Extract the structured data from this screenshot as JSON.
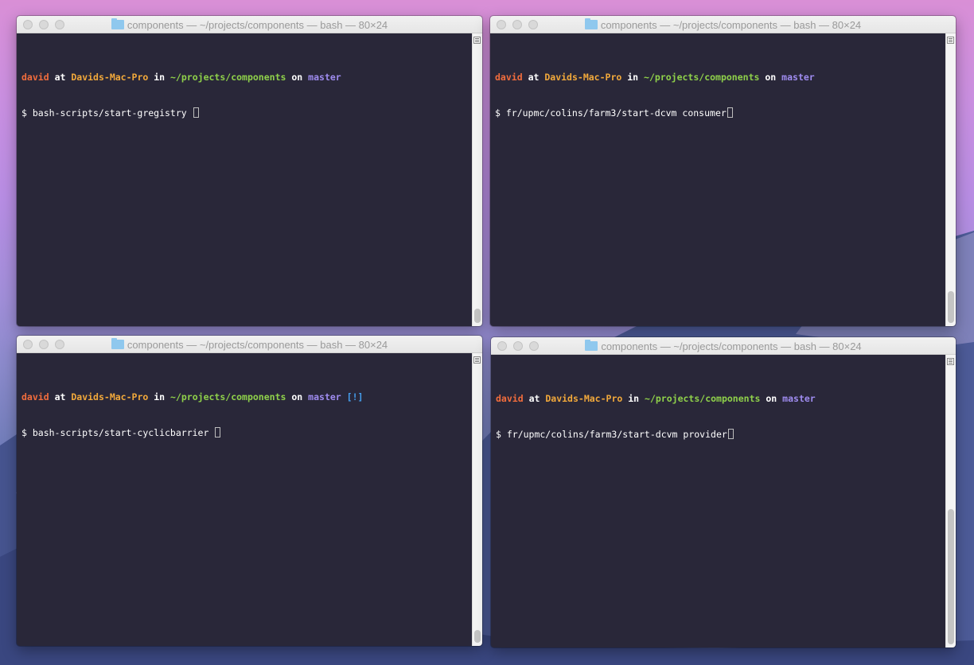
{
  "windows": [
    {
      "title": "components — ~/projects/components — bash — 80×24",
      "prompt": {
        "user": "david",
        "at": "at",
        "host": "Davids-Mac-Pro",
        "in": "in",
        "path": "~/projects/components",
        "on": "on",
        "branch": "master",
        "flag": ""
      },
      "command": "$ bash-scripts/start-gregistry "
    },
    {
      "title": "components — ~/projects/components — bash — 80×24",
      "prompt": {
        "user": "david",
        "at": "at",
        "host": "Davids-Mac-Pro",
        "in": "in",
        "path": "~/projects/components",
        "on": "on",
        "branch": "master",
        "flag": ""
      },
      "command": "$ fr/upmc/colins/farm3/start-dcvm consumer"
    },
    {
      "title": "components — ~/projects/components — bash — 80×24",
      "prompt": {
        "user": "david",
        "at": "at",
        "host": "Davids-Mac-Pro",
        "in": "in",
        "path": "~/projects/components",
        "on": "on",
        "branch": "master",
        "flag": "[!]"
      },
      "command": "$ bash-scripts/start-cyclicbarrier "
    },
    {
      "title": "components — ~/projects/components — bash — 80×24",
      "prompt": {
        "user": "david",
        "at": "at",
        "host": "Davids-Mac-Pro",
        "in": "in",
        "path": "~/projects/components",
        "on": "on",
        "branch": "master",
        "flag": ""
      },
      "command": "$ fr/upmc/colins/farm3/start-dcvm provider"
    }
  ],
  "colors": {
    "terminal_bg": "#292739",
    "user": "#f26d3d",
    "host": "#f2a93b",
    "path": "#8fd14a",
    "branch": "#9f8cf0",
    "flag": "#45a0f0"
  },
  "icons": [
    "folder-icon",
    "close-button-icon",
    "minimize-button-icon",
    "zoom-button-icon",
    "scrollback-menu-icon"
  ]
}
